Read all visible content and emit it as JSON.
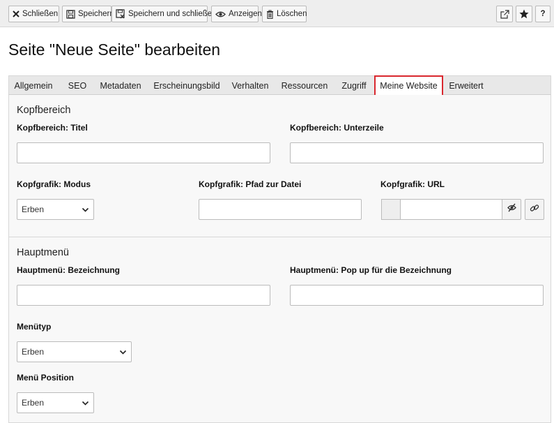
{
  "toolbar": {
    "close_label": "Schließen",
    "save_label": "Speichern",
    "save_close_label": "Speichern und schließen",
    "view_label": "Anzeigen",
    "delete_label": "Löschen",
    "help_label": "?"
  },
  "page": {
    "title": "Seite \"Neue Seite\" bearbeiten"
  },
  "tabs": [
    {
      "label": "Allgemein"
    },
    {
      "label": "SEO"
    },
    {
      "label": "Metadaten"
    },
    {
      "label": "Erscheinungsbild"
    },
    {
      "label": "Verhalten"
    },
    {
      "label": "Ressourcen"
    },
    {
      "label": "Zugriff"
    },
    {
      "label": "Meine Website",
      "active": true
    },
    {
      "label": "Erweitert"
    }
  ],
  "kopf": {
    "section_title": "Kopfbereich",
    "titel_label": "Kopfbereich: Titel",
    "titel_value": "",
    "unterzeile_label": "Kopfbereich: Unterzeile",
    "unterzeile_value": "",
    "modus_label": "Kopfgrafik: Modus",
    "modus_value": "Erben",
    "pfad_label": "Kopfgrafik: Pfad zur Datei",
    "pfad_value": "",
    "url_label": "Kopfgrafik: URL",
    "url_value": ""
  },
  "haupt": {
    "section_title": "Hauptmenü",
    "bezeichnung_label": "Hauptmenü: Bezeichnung",
    "bezeichnung_value": "",
    "popup_label": "Hauptmenü: Pop up für die Bezeichnung",
    "popup_value": "",
    "menutyp_label": "Menütyp",
    "menutyp_value": "Erben",
    "position_label": "Menü Position",
    "position_value": "Erben"
  },
  "colors": {
    "active_tab_border": "#d9272e",
    "toolbar_bg": "#eeeeee",
    "panel_bg": "#f8f8f8"
  },
  "icons": [
    "close-icon",
    "save-icon",
    "save-close-icon",
    "eye-icon",
    "trash-icon",
    "external-link-icon",
    "star-icon",
    "help-icon",
    "chevron-down-icon",
    "eye-slash-icon",
    "link-icon"
  ]
}
